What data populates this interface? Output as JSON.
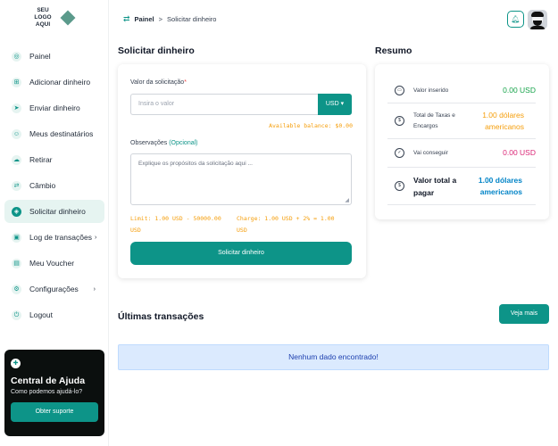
{
  "logo": {
    "text": "SEU LOGO AQUI"
  },
  "sidebar": {
    "items": [
      {
        "label": "Painel",
        "icon": "dashboard-icon",
        "glyph": "◎"
      },
      {
        "label": "Adicionar dinheiro",
        "icon": "add-money-icon",
        "glyph": "⊞"
      },
      {
        "label": "Enviar dinheiro",
        "icon": "send-icon",
        "glyph": "➤"
      },
      {
        "label": "Meus destinatários",
        "icon": "users-icon",
        "glyph": "☺"
      },
      {
        "label": "Retirar",
        "icon": "withdraw-icon",
        "glyph": "☁"
      },
      {
        "label": "Câmbio",
        "icon": "exchange-icon",
        "glyph": "⇄"
      },
      {
        "label": "Solicitar dinheiro",
        "icon": "request-money-icon",
        "glyph": "◈"
      },
      {
        "label": "Log de transações",
        "icon": "log-icon",
        "glyph": "▣"
      },
      {
        "label": "Meu Voucher",
        "icon": "voucher-icon",
        "glyph": "▤"
      },
      {
        "label": "Configurações",
        "icon": "settings-icon",
        "glyph": "⚙"
      },
      {
        "label": "Logout",
        "icon": "logout-icon",
        "glyph": "⏻"
      }
    ]
  },
  "help": {
    "title": "Central de Ajuda",
    "subtitle": "Como podemos ajudá-lo?",
    "button": "Obter suporte"
  },
  "breadcrumb": {
    "home": "Painel",
    "separator": ">",
    "current": "Solicitar dinheiro"
  },
  "form": {
    "title": "Solicitar dinheiro",
    "amount_label": "Valor da solicitação",
    "required_mark": "*",
    "amount_placeholder": "Insira o valor",
    "currency": "USD",
    "available": "Available balance: $0.00",
    "notes_label": "Observações",
    "notes_optional": "(Opcional)",
    "notes_placeholder": "Explique os propósitos da solicitação aqui ...",
    "limit_line1": "Limit: 1.00 USD - 50000.00",
    "limit_line2": "USD",
    "charge_line1": "Charge: 1.00 USD + 2% = 1.00",
    "charge_line2": "USD",
    "submit": "Solicitar dinheiro"
  },
  "summary": {
    "title": "Resumo",
    "rows": [
      {
        "label": "Valor inserido",
        "value": "0.00 USD",
        "color": "#16a34a"
      },
      {
        "label": "Total de Taxas e Encargos",
        "value": "1.00 dólares americanos",
        "color": "#f59e0b"
      },
      {
        "label": "Vai conseguir",
        "value": "0.00 USD",
        "color": "#db2777"
      },
      {
        "label": "Valor total a pagar",
        "value": "1.00 dólares americanos",
        "color": "#0284c7"
      }
    ]
  },
  "transactions": {
    "title": "Últimas transações",
    "see_more": "Veja mais",
    "empty": "Nenhum dado encontrado!"
  },
  "colors": {
    "accent": "#0d9488",
    "accent_light": "#e6f4f1"
  }
}
